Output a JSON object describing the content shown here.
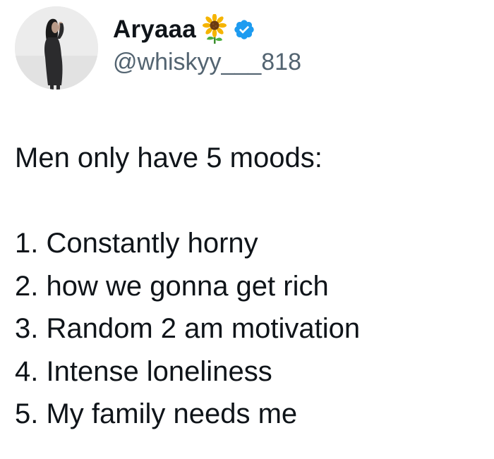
{
  "author": {
    "display_name": "Aryaaa",
    "emoji_icon": "sunflower-icon",
    "verified_badge": "verified-icon",
    "handle": "@whiskyy___818",
    "badge_color": "#1d9bf0"
  },
  "tweet": {
    "lines": [
      "Men only have 5 moods:",
      "",
      "1. Constantly horny",
      "2. how we gonna get rich",
      "3. Random 2 am motivation",
      "4. Intense loneliness",
      "5. My family needs me"
    ]
  }
}
